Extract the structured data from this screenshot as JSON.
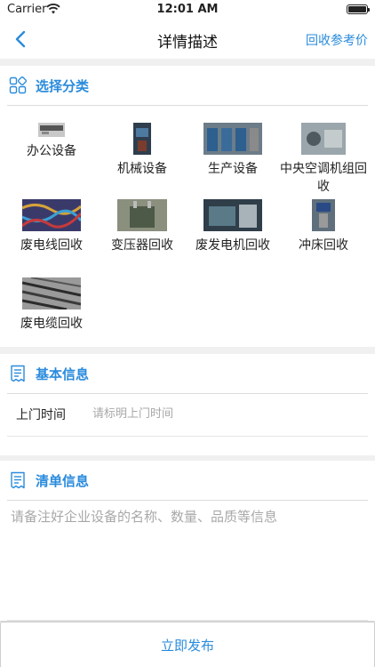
{
  "status_bar": {
    "carrier": "Carrier",
    "time": "12:01 AM"
  },
  "nav": {
    "title": "详情描述",
    "right_link": "回收参考价"
  },
  "category_section": {
    "title": "选择分类",
    "items": [
      {
        "label": "办公设备"
      },
      {
        "label": "机械设备"
      },
      {
        "label": "生产设备"
      },
      {
        "label": "中央空调机组回收"
      },
      {
        "label": "废电线回收"
      },
      {
        "label": "变压器回收"
      },
      {
        "label": "废发电机回收"
      },
      {
        "label": "冲床回收"
      },
      {
        "label": "废电缆回收"
      }
    ]
  },
  "basic_section": {
    "title": "基本信息",
    "visit_time_label": "上门时间",
    "visit_time_placeholder": "请标明上门时间",
    "visit_time_value": ""
  },
  "list_section": {
    "title": "清单信息",
    "placeholder": "请备注好企业设备的名称、数量、品质等信息",
    "value": ""
  },
  "footer": {
    "publish_label": "立即发布"
  },
  "colors": {
    "accent": "#2a8bdc",
    "background": "#f0f0f0"
  }
}
